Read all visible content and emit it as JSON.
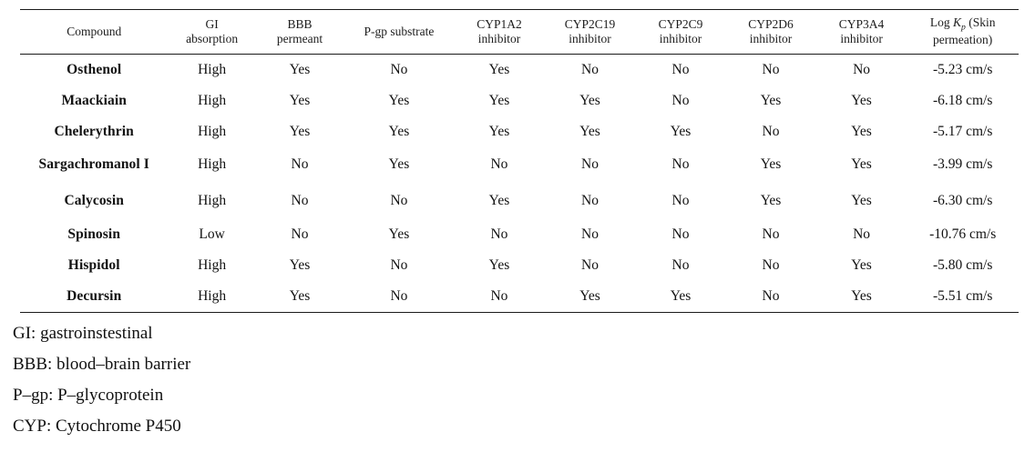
{
  "table": {
    "columns": [
      {
        "key": "compound",
        "line1": "Compound",
        "line2": ""
      },
      {
        "key": "gi",
        "line1": "GI",
        "line2": "absorption"
      },
      {
        "key": "bbb",
        "line1": "BBB",
        "line2": "permeant"
      },
      {
        "key": "pgp",
        "line1": "P-gp substrate",
        "line2": ""
      },
      {
        "key": "cyp1a2",
        "line1": "CYP1A2",
        "line2": "inhibitor"
      },
      {
        "key": "cyp2c19",
        "line1": "CYP2C19",
        "line2": "inhibitor"
      },
      {
        "key": "cyp2c9",
        "line1": "CYP2C9",
        "line2": "inhibitor"
      },
      {
        "key": "cyp2d6",
        "line1": "CYP2D6",
        "line2": "inhibitor"
      },
      {
        "key": "cyp3a4",
        "line1": "CYP3A4",
        "line2": "inhibitor"
      },
      {
        "key": "logkp",
        "line1": "Log Kp (Skin",
        "line2": "permeation)"
      }
    ],
    "logkp_header": {
      "prefix": "Log ",
      "italic_k": "K",
      "subscript": "p",
      "suffix": " (Skin",
      "line2": "permeation)"
    },
    "rows": [
      {
        "compound": "Osthenol",
        "gi": "High",
        "bbb": "Yes",
        "pgp": "No",
        "cyp1a2": "Yes",
        "cyp2c19": "No",
        "cyp2c9": "No",
        "cyp2d6": "No",
        "cyp3a4": "No",
        "logkp": "-5.23 cm/s"
      },
      {
        "compound": "Maackiain",
        "gi": "High",
        "bbb": "Yes",
        "pgp": "Yes",
        "cyp1a2": "Yes",
        "cyp2c19": "Yes",
        "cyp2c9": "No",
        "cyp2d6": "Yes",
        "cyp3a4": "Yes",
        "logkp": "-6.18 cm/s"
      },
      {
        "compound": "Chelerythrin",
        "gi": "High",
        "bbb": "Yes",
        "pgp": "Yes",
        "cyp1a2": "Yes",
        "cyp2c19": "Yes",
        "cyp2c9": "Yes",
        "cyp2d6": "No",
        "cyp3a4": "Yes",
        "logkp": "-5.17 cm/s"
      },
      {
        "compound": "Sargachromanol I",
        "gi": "High",
        "bbb": "No",
        "pgp": "Yes",
        "cyp1a2": "No",
        "cyp2c19": "No",
        "cyp2c9": "No",
        "cyp2d6": "Yes",
        "cyp3a4": "Yes",
        "logkp": "-3.99 cm/s"
      },
      {
        "compound": "Calycosin",
        "gi": "High",
        "bbb": "No",
        "pgp": "No",
        "cyp1a2": "Yes",
        "cyp2c19": "No",
        "cyp2c9": "No",
        "cyp2d6": "Yes",
        "cyp3a4": "Yes",
        "logkp": "-6.30 cm/s"
      },
      {
        "compound": "Spinosin",
        "gi": "Low",
        "bbb": "No",
        "pgp": "Yes",
        "cyp1a2": "No",
        "cyp2c19": "No",
        "cyp2c9": "No",
        "cyp2d6": "No",
        "cyp3a4": "No",
        "logkp": "-10.76 cm/s"
      },
      {
        "compound": "Hispidol",
        "gi": "High",
        "bbb": "Yes",
        "pgp": "No",
        "cyp1a2": "Yes",
        "cyp2c19": "No",
        "cyp2c9": "No",
        "cyp2d6": "No",
        "cyp3a4": "Yes",
        "logkp": "-5.80 cm/s"
      },
      {
        "compound": "Decursin",
        "gi": "High",
        "bbb": "Yes",
        "pgp": "No",
        "cyp1a2": "No",
        "cyp2c19": "Yes",
        "cyp2c9": "Yes",
        "cyp2d6": "No",
        "cyp3a4": "Yes",
        "logkp": "-5.51 cm/s"
      }
    ]
  },
  "footnotes": [
    "GI: gastroinstestinal",
    "BBB: blood–brain barrier",
    "P–gp: P–glycoprotein",
    "CYP: Cytochrome P450"
  ]
}
